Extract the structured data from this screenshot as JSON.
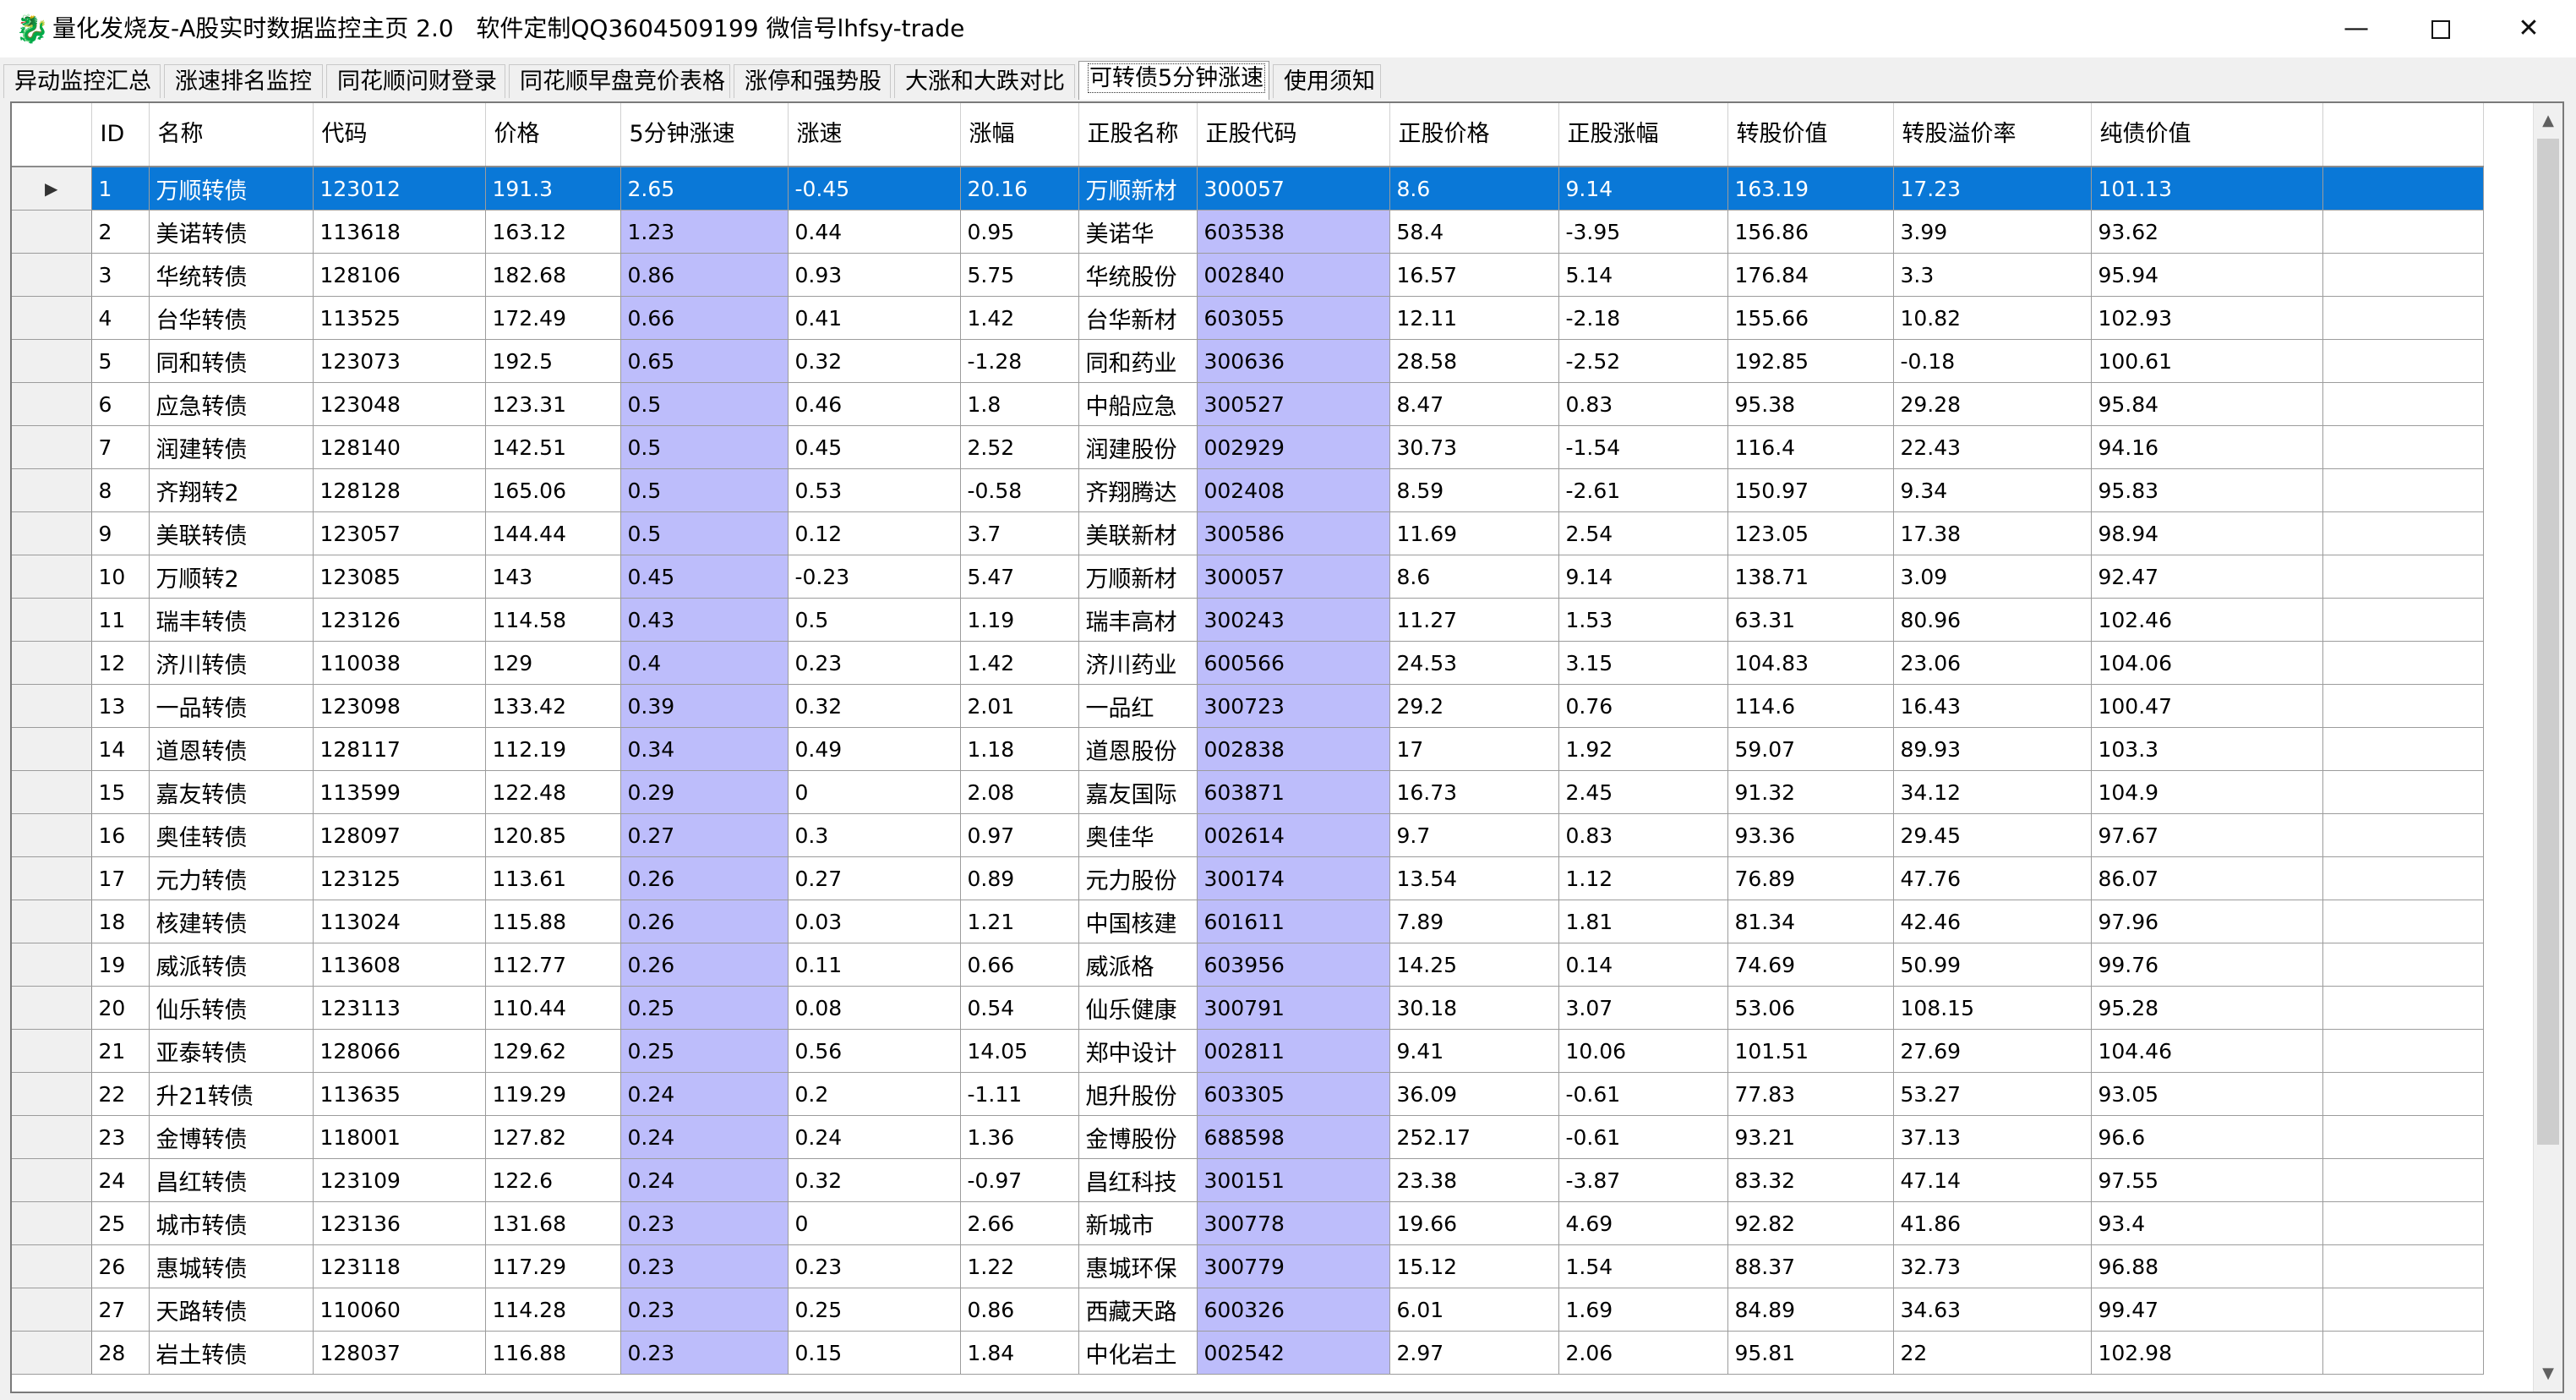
{
  "window": {
    "title": "量化发烧友-A股实时数据监控主页 2.0   软件定制QQ3604509199 微信号lhfsy-trade",
    "icon": "dragon-app-icon",
    "minimize_glyph": "—",
    "close_glyph": "✕"
  },
  "tabs": [
    {
      "label": "异动监控汇总"
    },
    {
      "label": "涨速排名监控"
    },
    {
      "label": "同花顺问财登录"
    },
    {
      "label": "同花顺早盘竞价表格"
    },
    {
      "label": "涨停和强势股"
    },
    {
      "label": "大涨和大跌对比"
    },
    {
      "label": "可转债5分钟涨速",
      "active": true
    },
    {
      "label": "使用须知"
    }
  ],
  "table": {
    "columns": [
      "ID",
      "名称",
      "代码",
      "价格",
      "5分钟涨速",
      "涨速",
      "涨幅",
      "正股名称",
      "正股代码",
      "正股价格",
      "正股涨幅",
      "转股价值",
      "转股溢价率",
      "纯债价值"
    ],
    "row_indicator": "▶",
    "highlight_color": "#bdbdfb",
    "selection_color": "#0a78d7",
    "rows": [
      [
        "1",
        "万顺转债",
        "123012",
        "191.3",
        "2.65",
        "-0.45",
        "20.16",
        "万顺新材",
        "300057",
        "8.6",
        "9.14",
        "163.19",
        "17.23",
        "101.13"
      ],
      [
        "2",
        "美诺转债",
        "113618",
        "163.12",
        "1.23",
        "0.44",
        "0.95",
        "美诺华",
        "603538",
        "58.4",
        "-3.95",
        "156.86",
        "3.99",
        "93.62"
      ],
      [
        "3",
        "华统转债",
        "128106",
        "182.68",
        "0.86",
        "0.93",
        "5.75",
        "华统股份",
        "002840",
        "16.57",
        "5.14",
        "176.84",
        "3.3",
        "95.94"
      ],
      [
        "4",
        "台华转债",
        "113525",
        "172.49",
        "0.66",
        "0.41",
        "1.42",
        "台华新材",
        "603055",
        "12.11",
        "-2.18",
        "155.66",
        "10.82",
        "102.93"
      ],
      [
        "5",
        "同和转债",
        "123073",
        "192.5",
        "0.65",
        "0.32",
        "-1.28",
        "同和药业",
        "300636",
        "28.58",
        "-2.52",
        "192.85",
        "-0.18",
        "100.61"
      ],
      [
        "6",
        "应急转债",
        "123048",
        "123.31",
        "0.5",
        "0.46",
        "1.8",
        "中船应急",
        "300527",
        "8.47",
        "0.83",
        "95.38",
        "29.28",
        "95.84"
      ],
      [
        "7",
        "润建转债",
        "128140",
        "142.51",
        "0.5",
        "0.45",
        "2.52",
        "润建股份",
        "002929",
        "30.73",
        "-1.54",
        "116.4",
        "22.43",
        "94.16"
      ],
      [
        "8",
        "齐翔转2",
        "128128",
        "165.06",
        "0.5",
        "0.53",
        "-0.58",
        "齐翔腾达",
        "002408",
        "8.59",
        "-2.61",
        "150.97",
        "9.34",
        "95.83"
      ],
      [
        "9",
        "美联转债",
        "123057",
        "144.44",
        "0.5",
        "0.12",
        "3.7",
        "美联新材",
        "300586",
        "11.69",
        "2.54",
        "123.05",
        "17.38",
        "98.94"
      ],
      [
        "10",
        "万顺转2",
        "123085",
        "143",
        "0.45",
        "-0.23",
        "5.47",
        "万顺新材",
        "300057",
        "8.6",
        "9.14",
        "138.71",
        "3.09",
        "92.47"
      ],
      [
        "11",
        "瑞丰转债",
        "123126",
        "114.58",
        "0.43",
        "0.5",
        "1.19",
        "瑞丰高材",
        "300243",
        "11.27",
        "1.53",
        "63.31",
        "80.96",
        "102.46"
      ],
      [
        "12",
        "济川转债",
        "110038",
        "129",
        "0.4",
        "0.23",
        "1.42",
        "济川药业",
        "600566",
        "24.53",
        "3.15",
        "104.83",
        "23.06",
        "104.06"
      ],
      [
        "13",
        "一品转债",
        "123098",
        "133.42",
        "0.39",
        "0.32",
        "2.01",
        "一品红",
        "300723",
        "29.2",
        "0.76",
        "114.6",
        "16.43",
        "100.47"
      ],
      [
        "14",
        "道恩转债",
        "128117",
        "112.19",
        "0.34",
        "0.49",
        "1.18",
        "道恩股份",
        "002838",
        "17",
        "1.92",
        "59.07",
        "89.93",
        "103.3"
      ],
      [
        "15",
        "嘉友转债",
        "113599",
        "122.48",
        "0.29",
        "0",
        "2.08",
        "嘉友国际",
        "603871",
        "16.73",
        "2.45",
        "91.32",
        "34.12",
        "104.9"
      ],
      [
        "16",
        "奥佳转债",
        "128097",
        "120.85",
        "0.27",
        "0.3",
        "0.97",
        "奥佳华",
        "002614",
        "9.7",
        "0.83",
        "93.36",
        "29.45",
        "97.67"
      ],
      [
        "17",
        "元力转债",
        "123125",
        "113.61",
        "0.26",
        "0.27",
        "0.89",
        "元力股份",
        "300174",
        "13.54",
        "1.12",
        "76.89",
        "47.76",
        "86.07"
      ],
      [
        "18",
        "核建转债",
        "113024",
        "115.88",
        "0.26",
        "0.03",
        "1.21",
        "中国核建",
        "601611",
        "7.89",
        "1.81",
        "81.34",
        "42.46",
        "97.96"
      ],
      [
        "19",
        "威派转债",
        "113608",
        "112.77",
        "0.26",
        "0.11",
        "0.66",
        "威派格",
        "603956",
        "14.25",
        "0.14",
        "74.69",
        "50.99",
        "99.76"
      ],
      [
        "20",
        "仙乐转债",
        "123113",
        "110.44",
        "0.25",
        "0.08",
        "0.54",
        "仙乐健康",
        "300791",
        "30.18",
        "3.07",
        "53.06",
        "108.15",
        "95.28"
      ],
      [
        "21",
        "亚泰转债",
        "128066",
        "129.62",
        "0.25",
        "0.56",
        "14.05",
        "郑中设计",
        "002811",
        "9.41",
        "10.06",
        "101.51",
        "27.69",
        "104.46"
      ],
      [
        "22",
        "升21转债",
        "113635",
        "119.29",
        "0.24",
        "0.2",
        "-1.11",
        "旭升股份",
        "603305",
        "36.09",
        "-0.61",
        "77.83",
        "53.27",
        "93.05"
      ],
      [
        "23",
        "金博转债",
        "118001",
        "127.82",
        "0.24",
        "0.24",
        "1.36",
        "金博股份",
        "688598",
        "252.17",
        "-0.61",
        "93.21",
        "37.13",
        "96.6"
      ],
      [
        "24",
        "昌红转债",
        "123109",
        "122.6",
        "0.24",
        "0.32",
        "-0.97",
        "昌红科技",
        "300151",
        "23.38",
        "-3.87",
        "83.32",
        "47.14",
        "97.55"
      ],
      [
        "25",
        "城市转债",
        "123136",
        "131.68",
        "0.23",
        "0",
        "2.66",
        "新城市",
        "300778",
        "19.66",
        "4.69",
        "92.82",
        "41.86",
        "93.4"
      ],
      [
        "26",
        "惠城转债",
        "123118",
        "117.29",
        "0.23",
        "0.23",
        "1.22",
        "惠城环保",
        "300779",
        "15.12",
        "1.54",
        "88.37",
        "32.73",
        "96.88"
      ],
      [
        "27",
        "天路转债",
        "110060",
        "114.28",
        "0.23",
        "0.25",
        "0.86",
        "西藏天路",
        "600326",
        "6.01",
        "1.69",
        "84.89",
        "34.63",
        "99.47"
      ],
      [
        "28",
        "岩土转债",
        "128037",
        "116.88",
        "0.23",
        "0.15",
        "1.84",
        "中化岩土",
        "002542",
        "2.97",
        "2.06",
        "95.81",
        "22",
        "102.98"
      ]
    ]
  }
}
